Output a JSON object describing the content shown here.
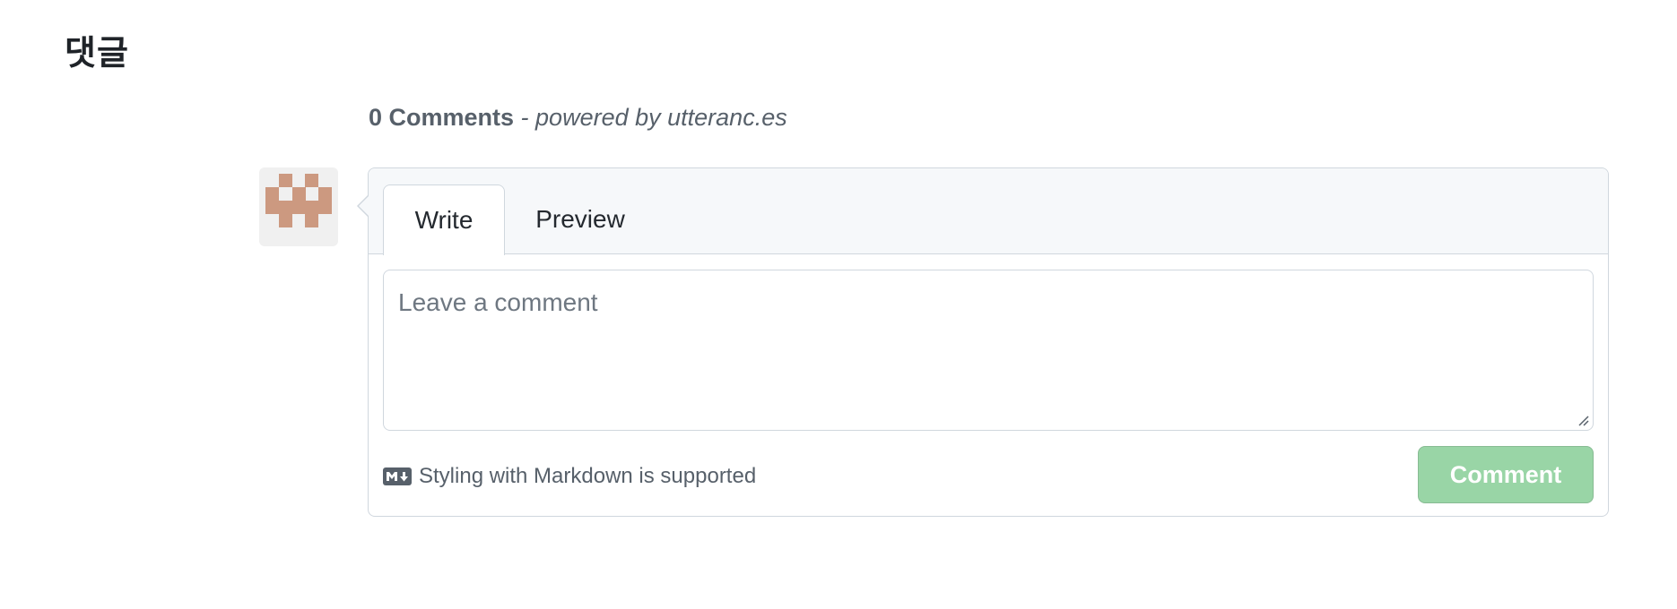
{
  "section": {
    "heading": "댓글"
  },
  "comments": {
    "count_label": "0 Comments",
    "powered_by": " - powered by utteranc.es"
  },
  "avatar": {
    "icon": "identicon-avatar",
    "color": "#cc9980"
  },
  "editor": {
    "tabs": [
      {
        "label": "Write",
        "active": true
      },
      {
        "label": "Preview",
        "active": false
      }
    ],
    "textarea_value": "",
    "textarea_placeholder": "Leave a comment",
    "markdown_icon": "markdown-icon",
    "markdown_note": "Styling with Markdown is supported",
    "submit_label": "Comment",
    "submit_color": "#94d3a2",
    "submit_disabled": true
  }
}
